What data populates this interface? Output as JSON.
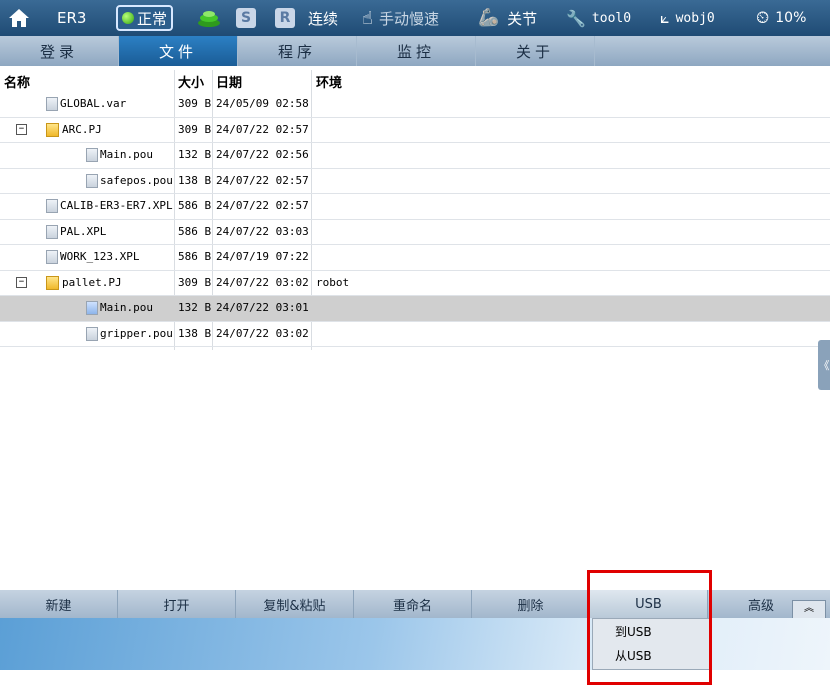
{
  "statusbar": {
    "robot": "ER3",
    "state": "正常",
    "s_badge": "S",
    "r_badge": "R",
    "run_mode": "连续",
    "speed_mode": "手动慢速",
    "coord": "关节",
    "tool": "tool0",
    "wobj": "wobj0",
    "speed": "10%"
  },
  "nav": {
    "tabs": [
      {
        "label": "登录"
      },
      {
        "label": "文件"
      },
      {
        "label": "程序"
      },
      {
        "label": "监控"
      },
      {
        "label": "关于"
      }
    ]
  },
  "table": {
    "headers": {
      "name": "名称",
      "size": "大小",
      "date": "日期",
      "env": "环境"
    },
    "rows": [
      {
        "name": "GLOBAL.var",
        "size": "309 B",
        "date": "24/05/09 02:58",
        "env": ""
      },
      {
        "name": "ARC.PJ",
        "size": "309 B",
        "date": "24/07/22 02:57",
        "env": ""
      },
      {
        "name": "Main.pou",
        "size": "132 B",
        "date": "24/07/22 02:56",
        "env": ""
      },
      {
        "name": "safepos.pou",
        "size": "138 B",
        "date": "24/07/22 02:57",
        "env": ""
      },
      {
        "name": "CALIB-ER3-ER7.XPL",
        "size": "586 B",
        "date": "24/07/22 02:57",
        "env": ""
      },
      {
        "name": "PAL.XPL",
        "size": "586 B",
        "date": "24/07/22 03:03",
        "env": ""
      },
      {
        "name": "WORK_123.XPL",
        "size": "586 B",
        "date": "24/07/19 07:22",
        "env": ""
      },
      {
        "name": "pallet.PJ",
        "size": "309 B",
        "date": "24/07/22 03:02",
        "env": "robot"
      },
      {
        "name": "Main.pou",
        "size": "132 B",
        "date": "24/07/22 03:01",
        "env": ""
      },
      {
        "name": "gripper.pou",
        "size": "138 B",
        "date": "24/07/22 03:02",
        "env": ""
      }
    ]
  },
  "toolbar": {
    "new": "新建",
    "open": "打开",
    "copy_paste": "复制&粘贴",
    "rename": "重命名",
    "delete": "删除",
    "usb": "USB",
    "advanced": "高级"
  },
  "usb_menu": {
    "to_usb": "到USB",
    "from_usb": "从USB"
  },
  "colors": {
    "active_tab": "#1a5c96",
    "highlight": "#e00000",
    "selected_row": "#cfcfcf"
  }
}
